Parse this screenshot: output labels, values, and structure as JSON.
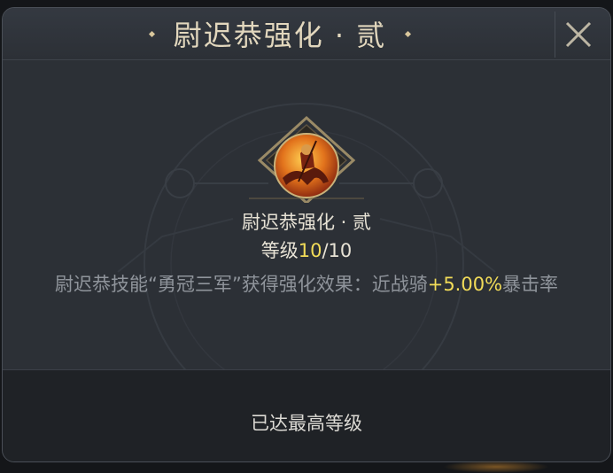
{
  "header": {
    "title": "尉迟恭强化 · 贰",
    "close_icon": "close-x-icon"
  },
  "skill": {
    "icon": "cavalry-general-portrait-icon",
    "name": "尉迟恭强化 · 贰",
    "level_label": "等级",
    "level_current": "10",
    "level_max": "/10",
    "desc_prefix": "尉迟恭技能“勇冠三军”获得强化效果：近战骑",
    "desc_value": "+5.00%",
    "desc_suffix": "暴击率"
  },
  "footer": {
    "status": "已达最高等级"
  },
  "colors": {
    "accent_yellow": "#f2dc58",
    "title_gold": "#e2d7bd",
    "panel_bg": "#2c3036"
  }
}
